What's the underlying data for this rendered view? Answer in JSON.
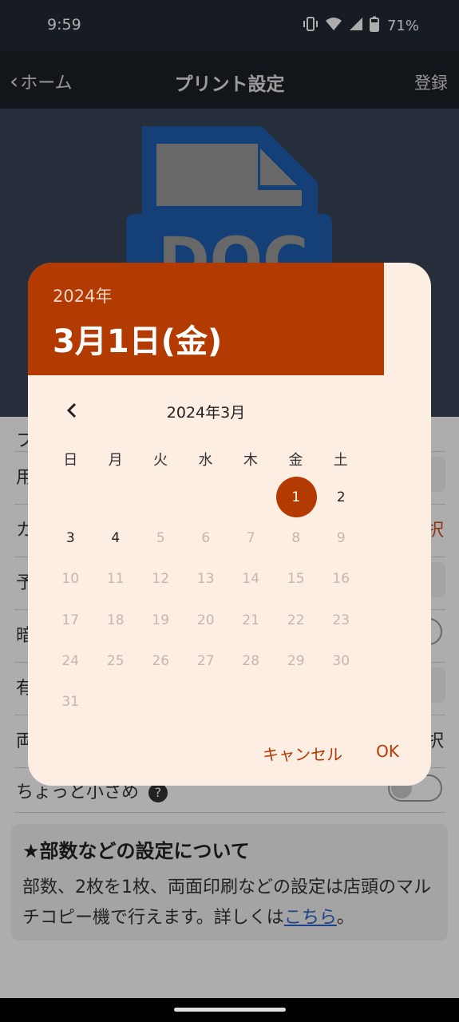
{
  "status_bar": {
    "time": "9:59",
    "battery": "71%"
  },
  "header": {
    "back_label": "ホーム",
    "title": "プリント設定",
    "register_label": "登録"
  },
  "hero": {
    "doc_label": "DOC"
  },
  "settings": {
    "row_labels": [
      "フ",
      "用",
      "カ",
      "予",
      "暗",
      "有",
      "両",
      "ちょっと小さめ"
    ],
    "select_label": "択",
    "help_icon_glyph": "?"
  },
  "info_box": {
    "title": "★部数などの設定について",
    "body": "部数、2枚を1枚、両面印刷などの設定は店頭のマルチコピー機で行えます。詳しくは",
    "link": "こちら",
    "suffix": "。"
  },
  "date_picker": {
    "header_year": "2024年",
    "header_date": "3月1日(金)",
    "month_label": "2024年3月",
    "weekdays": [
      "日",
      "月",
      "火",
      "水",
      "木",
      "金",
      "土"
    ],
    "days": [
      {
        "n": "1",
        "selected": true,
        "enabled": true
      },
      {
        "n": "2",
        "enabled": true
      },
      {
        "n": "3",
        "enabled": true
      },
      {
        "n": "4",
        "enabled": true
      },
      {
        "n": "5"
      },
      {
        "n": "6"
      },
      {
        "n": "7"
      },
      {
        "n": "8"
      },
      {
        "n": "9"
      },
      {
        "n": "10"
      },
      {
        "n": "11"
      },
      {
        "n": "12"
      },
      {
        "n": "13"
      },
      {
        "n": "14"
      },
      {
        "n": "15"
      },
      {
        "n": "16"
      },
      {
        "n": "17"
      },
      {
        "n": "18"
      },
      {
        "n": "19"
      },
      {
        "n": "20"
      },
      {
        "n": "21"
      },
      {
        "n": "22"
      },
      {
        "n": "23"
      },
      {
        "n": "24"
      },
      {
        "n": "25"
      },
      {
        "n": "26"
      },
      {
        "n": "27"
      },
      {
        "n": "28"
      },
      {
        "n": "29"
      },
      {
        "n": "30"
      },
      {
        "n": "31"
      }
    ],
    "cancel_label": "キャンセル",
    "ok_label": "OK",
    "accent_color": "#b33a00",
    "surface_color": "#fdeee4"
  }
}
